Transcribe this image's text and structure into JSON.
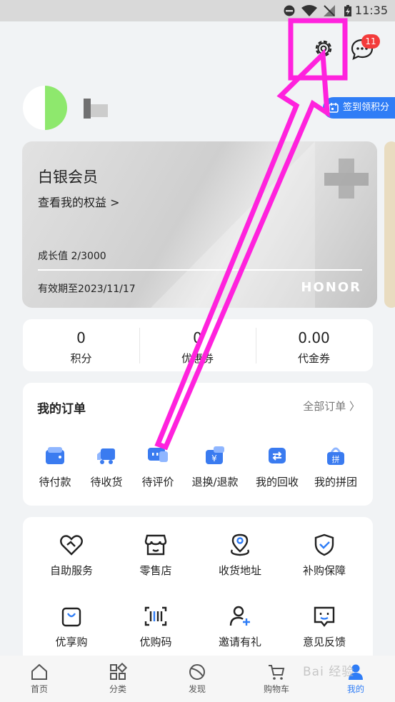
{
  "status_bar": {
    "time": "11:35"
  },
  "header": {
    "message_badge": "11"
  },
  "profile": {
    "checkin_label": "签到领积分"
  },
  "member_card": {
    "level": "白银会员",
    "rights_link": "查看我的权益 >",
    "growth": "成长值 2/3000",
    "expiry": "有效期至2023/11/17",
    "brand": "HONOR"
  },
  "points": [
    {
      "value": "0",
      "label": "积分"
    },
    {
      "value": "0",
      "label": "优惠券"
    },
    {
      "value": "0.00",
      "label": "代金券"
    }
  ],
  "orders": {
    "title": "我的订单",
    "all_label": "全部订单 〉",
    "items": [
      {
        "label": "待付款",
        "icon": "wallet-icon"
      },
      {
        "label": "待收货",
        "icon": "truck-icon"
      },
      {
        "label": "待评价",
        "icon": "comment-icon"
      },
      {
        "label": "退换/退款",
        "icon": "refund-icon"
      },
      {
        "label": "我的回收",
        "icon": "recycle-icon"
      },
      {
        "label": "我的拼团",
        "icon": "group-buy-icon"
      }
    ]
  },
  "services": [
    {
      "label": "自助服务",
      "icon": "handshake-heart-icon"
    },
    {
      "label": "零售店",
      "icon": "store-icon"
    },
    {
      "label": "收货地址",
      "icon": "location-pin-icon"
    },
    {
      "label": "补购保障",
      "icon": "shield-check-icon"
    },
    {
      "label": "优享购",
      "icon": "shopping-bag-icon"
    },
    {
      "label": "优购码",
      "icon": "barcode-icon"
    },
    {
      "label": "邀请有礼",
      "icon": "invite-user-icon"
    },
    {
      "label": "意见反馈",
      "icon": "feedback-icon"
    }
  ],
  "bottom_nav": [
    {
      "label": "首页",
      "icon": "home-icon"
    },
    {
      "label": "分类",
      "icon": "category-icon"
    },
    {
      "label": "发现",
      "icon": "discover-icon"
    },
    {
      "label": "购物车",
      "icon": "cart-icon"
    },
    {
      "label": "我的",
      "icon": "profile-icon",
      "active": true
    }
  ],
  "watermark": "Bai 经验",
  "colors": {
    "accent": "#2f7df6",
    "badge": "#f33b3b",
    "annotation": "#ff22dd"
  }
}
